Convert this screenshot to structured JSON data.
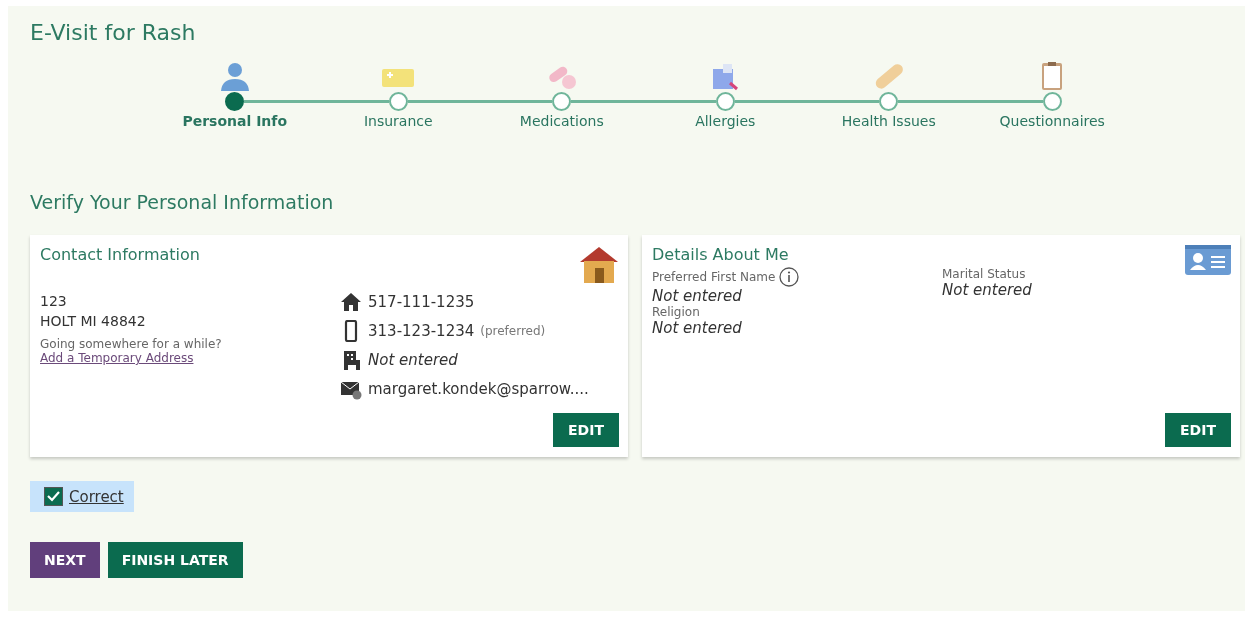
{
  "title": "E-Visit for Rash",
  "steps": [
    {
      "label": "Personal Info",
      "kind": "person",
      "selected": true
    },
    {
      "label": "Insurance",
      "kind": "card",
      "selected": false
    },
    {
      "label": "Medications",
      "kind": "pills",
      "selected": false
    },
    {
      "label": "Allergies",
      "kind": "allergy",
      "selected": false
    },
    {
      "label": "Health Issues",
      "kind": "bandage",
      "selected": false
    },
    {
      "label": "Questionnaires",
      "kind": "clipboard",
      "selected": false
    }
  ],
  "section_title": "Verify Your Personal Information",
  "contact": {
    "title": "Contact Information",
    "address": [
      "123",
      "HOLT MI 48842"
    ],
    "away_prompt": "Going somewhere for a while?",
    "temp_address_link": "Add a Temporary Address",
    "rows": [
      {
        "kind": "home",
        "value": "517-111-1235"
      },
      {
        "kind": "mobile",
        "value": "313-123-1234",
        "note": "(preferred)"
      },
      {
        "kind": "work",
        "value": "Not entered",
        "empty": true
      },
      {
        "kind": "email",
        "value": "margaret.kondek@sparrow...."
      }
    ],
    "edit": "EDIT"
  },
  "details": {
    "title": "Details About Me",
    "fields": [
      {
        "label": "Preferred First Name",
        "value": "Not entered",
        "info": true
      },
      {
        "label": "Marital Status",
        "value": "Not entered"
      },
      {
        "label": "Religion",
        "value": "Not entered"
      }
    ],
    "edit": "EDIT"
  },
  "confirm": {
    "label": "Correct",
    "checked": true
  },
  "buttons": [
    {
      "label": "NEXT",
      "kind": "primary"
    },
    {
      "label": "FINISH LATER",
      "kind": "secondary"
    }
  ]
}
